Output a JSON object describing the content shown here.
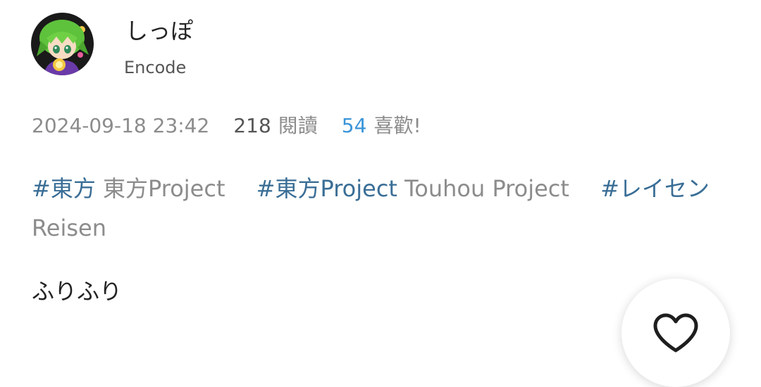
{
  "user": {
    "name": "しっぽ",
    "handle": "Encode"
  },
  "meta": {
    "datetime": "2024-09-18 23:42",
    "views_count": "218",
    "views_label": "閱讀",
    "likes_count": "54",
    "likes_label": "喜歡!"
  },
  "tags": [
    {
      "tag": "#東方",
      "desc": "東方Project"
    },
    {
      "tag": "#東方Project",
      "desc": "Touhou Project"
    },
    {
      "tag": "#レイセン",
      "desc": "Reisen"
    }
  ],
  "post": {
    "text": "ふりふり"
  },
  "icons": {
    "avatar": "user-avatar",
    "like": "heart-outline-icon"
  },
  "colors": {
    "tag_link": "#3a6e96",
    "likes_accent": "#3a95d9",
    "muted_text": "#8c8c8c"
  }
}
